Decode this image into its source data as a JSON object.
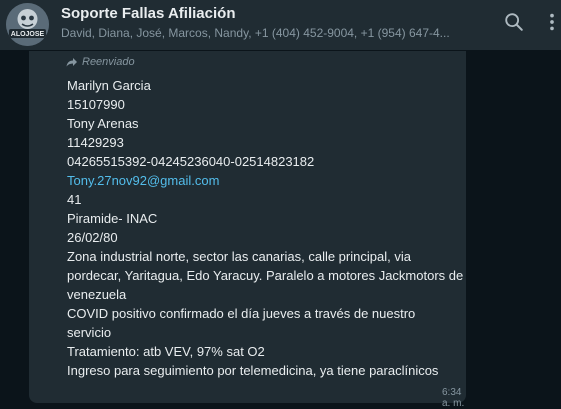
{
  "header": {
    "title": "Soporte Fallas Afiliación",
    "participants": "David, Diana, José, Marcos, Nandy, +1 (404) 452-9004, +1 (954) 647-4...",
    "avatar_text": "ALOJOSE",
    "icons": {
      "search": "search-icon",
      "menu": "more-vert-icon"
    }
  },
  "message": {
    "forwarded_label": "Reenviado",
    "lines": [
      "Marilyn Garcia",
      "15107990",
      "Tony Arenas",
      "11429293",
      "04265515392-04245236040-02514823182",
      "Tony.27nov92@gmail.com",
      "41",
      "Piramide- INAC",
      "26/02/80",
      "Zona industrial norte, sector las canarias, calle principal, via",
      "pordecar, Yaritagua, Edo Yaracuy. Paralelo a motores Jackmotors de",
      "venezuela",
      "COVID positivo confirmado el día jueves a través de nuestro",
      "servicio",
      "Tratamiento: atb VEV,   97% sat O2",
      "Ingreso para seguimiento por telemedicina, ya tiene paraclínicos"
    ],
    "time": "6:34 a. m."
  },
  "colors": {
    "header_bg": "#202c33",
    "chat_bg": "#0b141a",
    "bubble_bg": "#202c33",
    "link": "#53bdeb"
  }
}
